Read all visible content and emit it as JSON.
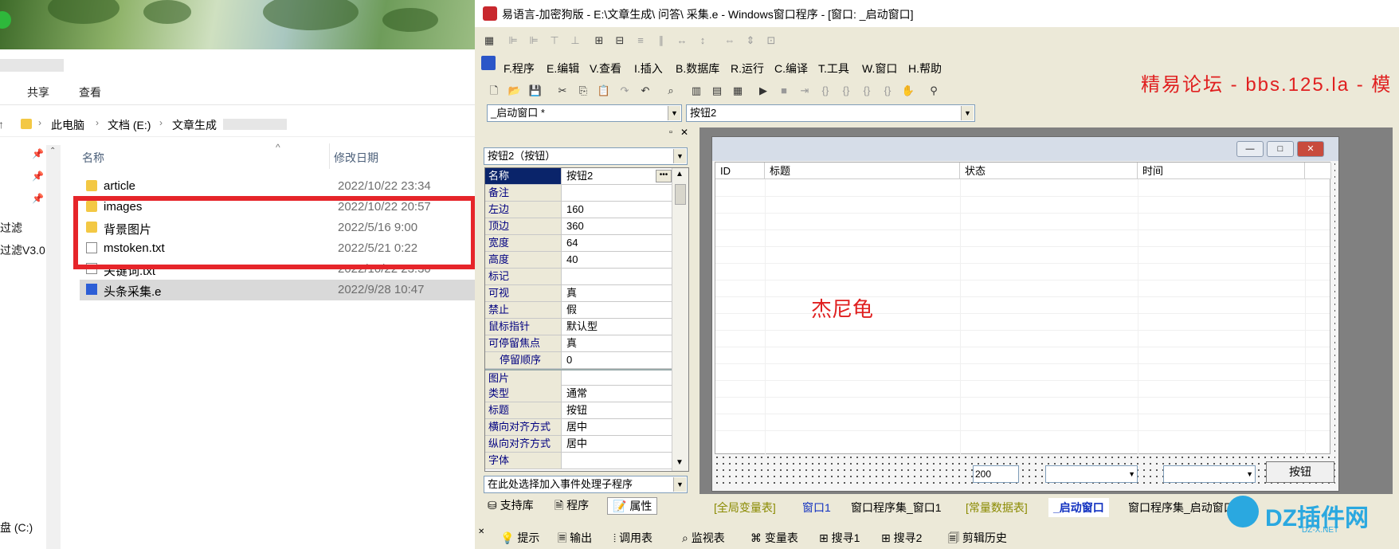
{
  "explorer": {
    "ribbon_tabs": [
      "共享",
      "查看"
    ],
    "breadcrumb": [
      "此电脑",
      "文档 (E:)",
      "文章生成"
    ],
    "columns": {
      "name": "名称",
      "date": "修改日期"
    },
    "files": [
      {
        "name": "article",
        "date": "2022/10/22 23:34",
        "type": "folder"
      },
      {
        "name": "images",
        "date": "2022/10/22 20:57",
        "type": "folder"
      },
      {
        "name": "背景图片",
        "date": "2022/5/16 9:00",
        "type": "folder"
      },
      {
        "name": "mstoken.txt",
        "date": "2022/5/21 0:22",
        "type": "txt"
      },
      {
        "name": "关键词.txt",
        "date": "2022/10/22 23:30",
        "type": "txt"
      },
      {
        "name": "头条采集.e",
        "date": "2022/9/28 10:47",
        "type": "e"
      }
    ],
    "nav_labels": [
      "过滤",
      "过滤V3.0",
      "盘 (C:)"
    ]
  },
  "ide": {
    "title": "易语言-加密狗版 - E:\\文章生成\\  问答\\  采集.e - Windows窗口程序 - [窗口: _启动窗口]",
    "menu": [
      "F.程序",
      "E.编辑",
      "V.查看",
      "I.插入",
      "B.数据库",
      "R.运行",
      "C.编译",
      "T.工具",
      "W.窗口",
      "H.帮助"
    ],
    "window_combo": "_启动窗口 *",
    "component_combo": "按钮2",
    "prop_combo": "按钮2（按钮）",
    "properties": [
      {
        "k": "名称",
        "v": "按钮2"
      },
      {
        "k": "备注",
        "v": ""
      },
      {
        "k": "左边",
        "v": "160"
      },
      {
        "k": "顶边",
        "v": "360"
      },
      {
        "k": "宽度",
        "v": "64"
      },
      {
        "k": "高度",
        "v": "40"
      },
      {
        "k": "标记",
        "v": ""
      },
      {
        "k": "可视",
        "v": "真"
      },
      {
        "k": "禁止",
        "v": "假"
      },
      {
        "k": "鼠标指针",
        "v": "默认型"
      },
      {
        "k": "可停留焦点",
        "v": "真"
      },
      {
        "k": "停留顺序",
        "v": "0"
      },
      {
        "k": "图片",
        "v": ""
      },
      {
        "k": "类型",
        "v": "通常"
      },
      {
        "k": "标题",
        "v": "按钮"
      },
      {
        "k": "横向对齐方式",
        "v": "居中"
      },
      {
        "k": "纵向对齐方式",
        "v": "居中"
      },
      {
        "k": "字体",
        "v": ""
      }
    ],
    "event_combo": "在此处选择加入事件处理子程序",
    "panel_tabs": [
      "支持库",
      "程序",
      "属性"
    ],
    "listview_columns": [
      "ID",
      "标题",
      "状态",
      "时间"
    ],
    "form_label": "杰尼龟",
    "form_input_value": "200",
    "form_button": "按钮",
    "editor_tabs": [
      "[全局变量表]",
      "窗口1",
      "窗口程序集_窗口1",
      "[常量数据表]",
      "_启动窗口",
      "窗口程序集_启动窗口"
    ],
    "bottom_tabs": [
      "提示",
      "输出",
      "调用表",
      "监视表",
      "变量表",
      "搜寻1",
      "搜寻2",
      "剪辑历史"
    ],
    "red_banner": "精易论坛 - bbs.125.la - 模"
  },
  "watermark": {
    "text": "DZ插件网",
    "sub": "DZ-X.NET"
  }
}
